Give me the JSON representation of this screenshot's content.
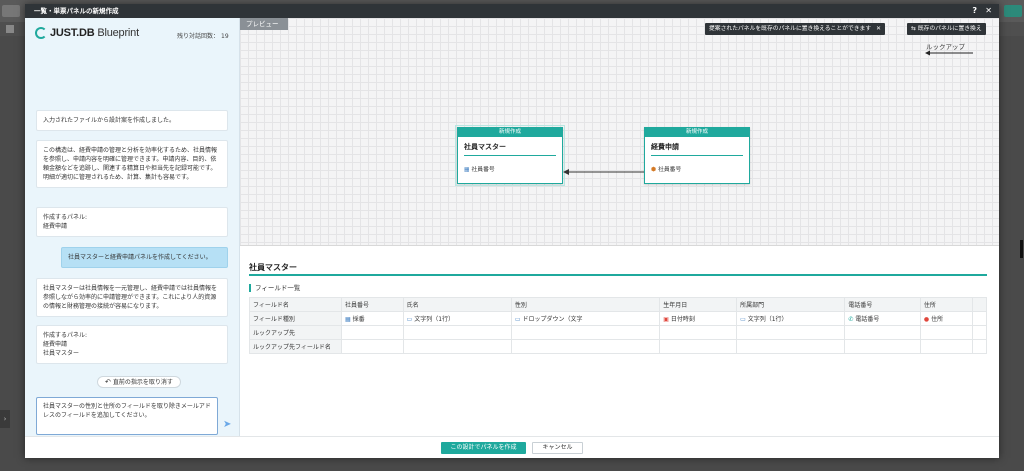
{
  "dialog": {
    "title": "一覧・単票パネルの新規作成",
    "help": "?",
    "close": "✕"
  },
  "colors": {
    "accent": "#1fa99d",
    "user_bubble": "#b6e0f5",
    "dark_bar": "#2f3438"
  },
  "left": {
    "logo_main": "JUST.DB",
    "logo_sub": "Blueprint",
    "remaining_label": "残り対話回数：",
    "remaining_count": "19",
    "messages": [
      {
        "role": "assistant",
        "text": "入力されたファイルから設計案を作成しました。"
      },
      {
        "role": "assistant",
        "text": "この構造は、経費申請の管理と分析を効率化するため、社員情報を参照し、申請内容を明確に管理できます。申請内容、目的、依頼金額などを追跡し、関連する精算日や担当先を記録可能です。明細が適切に管理されるため、計算、集計も容易です。"
      },
      {
        "role": "assistant",
        "text_lines": [
          "作成するパネル:",
          "経費申請"
        ]
      },
      {
        "role": "user",
        "text": "社員マスターと経費申請パネルを作成してください。"
      },
      {
        "role": "assistant",
        "text": "社員マスターは社員情報を一元管理し、経費申請では社員情報を参照しながら効率的に申請管理ができます。これにより人的資源の情報と財務管理の接続が容易になります。"
      },
      {
        "role": "assistant",
        "text_lines": [
          "作成するパネル:",
          "経費申請",
          "社員マスター"
        ]
      }
    ],
    "undo_label": "直前の指示を取り消す",
    "input_value": "社員マスターの性別と住所のフィールドを取り除きメールアドレスのフィールドを追加してください。",
    "send_icon": "send-icon"
  },
  "preview": {
    "tab_label": "プレビュー",
    "suggest_text": "提案されたパネルを既存のパネルに置き換えることができます",
    "suggest_close": "✕",
    "replace_label": "既存のパネルに置き換え",
    "legend_label": "ルックアップ",
    "panels": [
      {
        "badge": "新規作成",
        "name": "社員マスター",
        "field": "社員番号",
        "field_icon": "key-icon"
      },
      {
        "badge": "新規作成",
        "name": "経費申請",
        "field": "社員番号",
        "field_icon": "lookup-icon"
      }
    ]
  },
  "detail": {
    "title": "社員マスター",
    "fields_label": "フィールド一覧",
    "row_headers": [
      "フィールド名",
      "フィールド種別",
      "ルックアップ先",
      "ルックアップ先フィールド名"
    ],
    "columns": [
      {
        "name": "社員番号",
        "type": "採番",
        "icon": "numbering-icon"
      },
      {
        "name": "氏名",
        "type": "文字列（1行）",
        "icon": "text-icon"
      },
      {
        "name": "性別",
        "type": "ドロップダウン（文字",
        "icon": "dropdown-icon"
      },
      {
        "name": "生年月日",
        "type": "日付時刻",
        "icon": "calendar-icon"
      },
      {
        "name": "所属部門",
        "type": "文字列（1行）",
        "icon": "text-icon"
      },
      {
        "name": "電話番号",
        "type": "電話番号",
        "icon": "phone-icon"
      },
      {
        "name": "住所",
        "type": "住所",
        "icon": "location-icon"
      }
    ]
  },
  "footer": {
    "primary_label": "この設計でパネルを作成",
    "cancel_label": "キャンセル"
  }
}
